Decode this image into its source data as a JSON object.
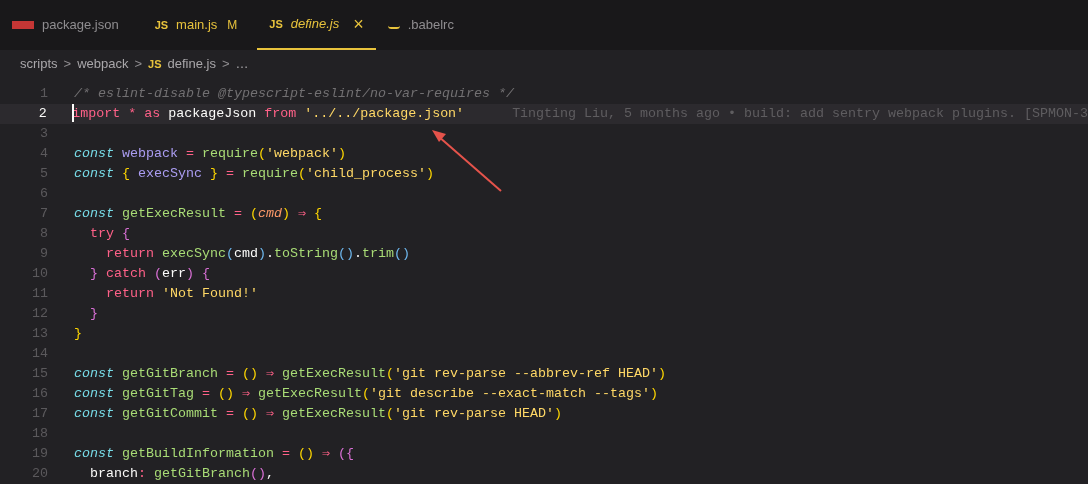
{
  "tabs": [
    {
      "label": "package.json",
      "kind": "npm",
      "selected": false,
      "modified": false
    },
    {
      "label": "main.js",
      "kind": "js",
      "icon_text": "JS",
      "selected": false,
      "modified": true,
      "badge": "M"
    },
    {
      "label": "define.js",
      "kind": "js",
      "icon_text": "JS",
      "selected": true,
      "modified": false,
      "close": "×"
    },
    {
      "label": ".babelrc",
      "kind": "babel",
      "selected": false,
      "modified": false
    }
  ],
  "breadcrumb": [
    {
      "label": "scripts",
      "kind": "folder"
    },
    {
      "label": "webpack",
      "kind": "folder"
    },
    {
      "label": "define.js",
      "kind": "js",
      "icon_text": "JS"
    },
    {
      "label": "…",
      "kind": "more"
    }
  ],
  "breadcrumb_separators": [
    ">",
    ">",
    ">"
  ],
  "lines": [
    {
      "number": "1",
      "tokens": [
        {
          "t": "/* eslint-disable @typescript-eslint/no-var-requires */",
          "kind": "comment"
        }
      ]
    },
    {
      "number": "2",
      "current": true,
      "blame": "Tingting Liu, 5 months ago • build: add sentry webpack plugins. [SPMON-3",
      "tokens": [
        {
          "t": "import ",
          "kind": "kw"
        },
        {
          "t": "* ",
          "kind": "op"
        },
        {
          "t": "as ",
          "kind": "kw"
        },
        {
          "t": "packageJson ",
          "kind": "plain"
        },
        {
          "t": "from ",
          "kind": "kw"
        },
        {
          "t": "'../../package.json'",
          "kind": "str"
        }
      ]
    },
    {
      "number": "3"
    },
    {
      "number": "4",
      "tokens": [
        {
          "t": "const ",
          "kind": "storage"
        },
        {
          "t": "webpack ",
          "kind": "var"
        },
        {
          "t": "= ",
          "kind": "op"
        },
        {
          "t": "require",
          "kind": "fn"
        },
        {
          "t": "(",
          "kind": "b1"
        },
        {
          "t": "'webpack'",
          "kind": "str"
        },
        {
          "t": ")",
          "kind": "b1"
        }
      ]
    },
    {
      "number": "5",
      "tokens": [
        {
          "t": "const ",
          "kind": "storage"
        },
        {
          "t": "{ ",
          "kind": "b1"
        },
        {
          "t": "execSync ",
          "kind": "var"
        },
        {
          "t": "} ",
          "kind": "b1"
        },
        {
          "t": "= ",
          "kind": "op"
        },
        {
          "t": "require",
          "kind": "fn"
        },
        {
          "t": "(",
          "kind": "b1"
        },
        {
          "t": "'child_process'",
          "kind": "str"
        },
        {
          "t": ")",
          "kind": "b1"
        }
      ]
    },
    {
      "number": "6"
    },
    {
      "number": "7",
      "tokens": [
        {
          "t": "const ",
          "kind": "storage"
        },
        {
          "t": "getExecResult ",
          "kind": "fn"
        },
        {
          "t": "= ",
          "kind": "op"
        },
        {
          "t": "(",
          "kind": "b1"
        },
        {
          "t": "cmd",
          "kind": "param"
        },
        {
          "t": ") ",
          "kind": "b1"
        },
        {
          "t": "⇒ ",
          "kind": "op"
        },
        {
          "t": "{",
          "kind": "b1"
        }
      ]
    },
    {
      "number": "8",
      "tokens": [
        {
          "t": "  try ",
          "kind": "kw"
        },
        {
          "t": "{",
          "kind": "b2"
        }
      ]
    },
    {
      "number": "9",
      "tokens": [
        {
          "t": "    return ",
          "kind": "kw"
        },
        {
          "t": "execSync",
          "kind": "fn"
        },
        {
          "t": "(",
          "kind": "b3"
        },
        {
          "t": "cmd",
          "kind": "plain"
        },
        {
          "t": ")",
          "kind": "b3"
        },
        {
          "t": ".",
          "kind": "plain"
        },
        {
          "t": "toString",
          "kind": "fn"
        },
        {
          "t": "()",
          "kind": "b3"
        },
        {
          "t": ".",
          "kind": "plain"
        },
        {
          "t": "trim",
          "kind": "fn"
        },
        {
          "t": "()",
          "kind": "b3"
        }
      ]
    },
    {
      "number": "10",
      "tokens": [
        {
          "t": "  } ",
          "kind": "b2"
        },
        {
          "t": "catch ",
          "kind": "kw"
        },
        {
          "t": "(",
          "kind": "b2"
        },
        {
          "t": "err",
          "kind": "plain"
        },
        {
          "t": ") {",
          "kind": "b2"
        }
      ]
    },
    {
      "number": "11",
      "tokens": [
        {
          "t": "    return ",
          "kind": "kw"
        },
        {
          "t": "'Not Found!'",
          "kind": "str"
        }
      ]
    },
    {
      "number": "12",
      "tokens": [
        {
          "t": "  }",
          "kind": "b2"
        }
      ]
    },
    {
      "number": "13",
      "tokens": [
        {
          "t": "}",
          "kind": "b1"
        }
      ]
    },
    {
      "number": "14"
    },
    {
      "number": "15",
      "tokens": [
        {
          "t": "const ",
          "kind": "storage"
        },
        {
          "t": "getGitBranch ",
          "kind": "fn"
        },
        {
          "t": "= ",
          "kind": "op"
        },
        {
          "t": "() ",
          "kind": "b1"
        },
        {
          "t": "⇒ ",
          "kind": "op"
        },
        {
          "t": "getExecResult",
          "kind": "fn"
        },
        {
          "t": "(",
          "kind": "b1"
        },
        {
          "t": "'git rev-parse --abbrev-ref HEAD'",
          "kind": "str"
        },
        {
          "t": ")",
          "kind": "b1"
        }
      ]
    },
    {
      "number": "16",
      "tokens": [
        {
          "t": "const ",
          "kind": "storage"
        },
        {
          "t": "getGitTag ",
          "kind": "fn"
        },
        {
          "t": "= ",
          "kind": "op"
        },
        {
          "t": "() ",
          "kind": "b1"
        },
        {
          "t": "⇒ ",
          "kind": "op"
        },
        {
          "t": "getExecResult",
          "kind": "fn"
        },
        {
          "t": "(",
          "kind": "b1"
        },
        {
          "t": "'git describe --exact-match --tags'",
          "kind": "str"
        },
        {
          "t": ")",
          "kind": "b1"
        }
      ]
    },
    {
      "number": "17",
      "tokens": [
        {
          "t": "const ",
          "kind": "storage"
        },
        {
          "t": "getGitCommit ",
          "kind": "fn"
        },
        {
          "t": "= ",
          "kind": "op"
        },
        {
          "t": "() ",
          "kind": "b1"
        },
        {
          "t": "⇒ ",
          "kind": "op"
        },
        {
          "t": "getExecResult",
          "kind": "fn"
        },
        {
          "t": "(",
          "kind": "b1"
        },
        {
          "t": "'git rev-parse HEAD'",
          "kind": "str"
        },
        {
          "t": ")",
          "kind": "b1"
        }
      ]
    },
    {
      "number": "18"
    },
    {
      "number": "19",
      "tokens": [
        {
          "t": "const ",
          "kind": "storage"
        },
        {
          "t": "getBuildInformation ",
          "kind": "fn"
        },
        {
          "t": "= ",
          "kind": "op"
        },
        {
          "t": "() ",
          "kind": "b1"
        },
        {
          "t": "⇒ ",
          "kind": "op"
        },
        {
          "t": "({",
          "kind": "b2"
        }
      ]
    },
    {
      "number": "20",
      "tokens": [
        {
          "t": "  branch",
          "kind": "plain"
        },
        {
          "t": ": ",
          "kind": "op"
        },
        {
          "t": "getGitBranch",
          "kind": "fn"
        },
        {
          "t": "()",
          "kind": "b2"
        },
        {
          "t": ",",
          "kind": "plain"
        }
      ]
    }
  ]
}
